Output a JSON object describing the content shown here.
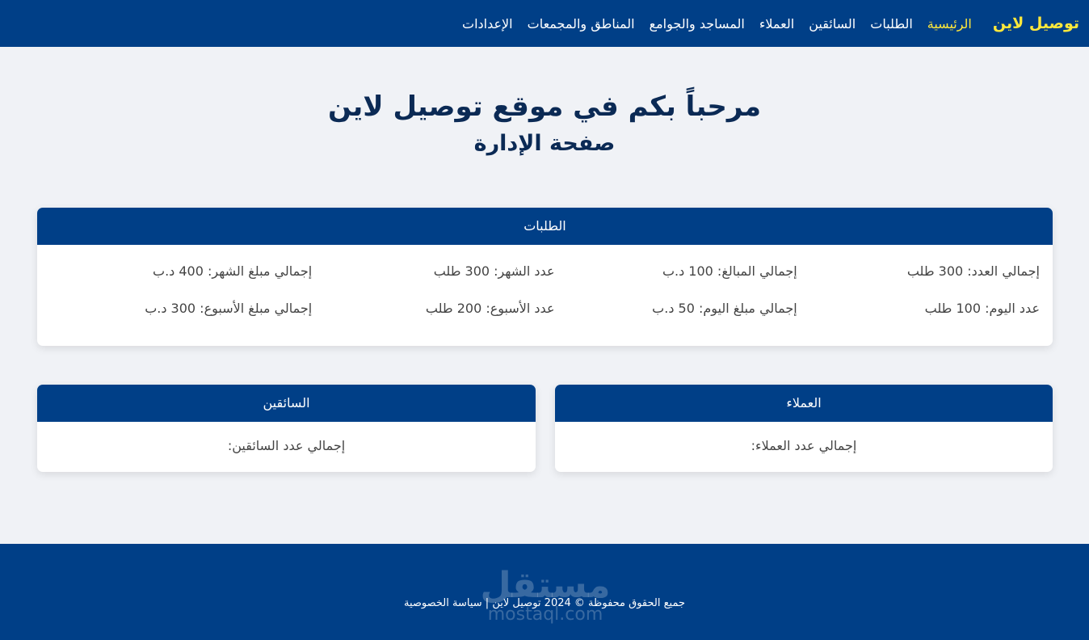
{
  "nav": {
    "brand": "توصيل لاين",
    "links": [
      "الرئيسية",
      "الطلبات",
      "السائقين",
      "العملاء",
      "المساجد والجوامع",
      "المناطق والمجمعات",
      "الإعدادات"
    ],
    "active_index": 0
  },
  "hero": {
    "title": "مرحباً بكم في موقع توصيل لاين",
    "subtitle": "صفحة الإدارة"
  },
  "orders": {
    "header": "الطلبات",
    "stats": [
      "إجمالي العدد: 300 طلب",
      "إجمالي المبالغ: 100 د.ب",
      "عدد الشهر: 300 طلب",
      "إجمالي مبلغ الشهر: 400 د.ب",
      "عدد اليوم: 100 طلب",
      "إجمالي مبلغ اليوم: 50 د.ب",
      "عدد الأسبوع: 200 طلب",
      "إجمالي مبلغ الأسبوع: 300 د.ب"
    ]
  },
  "customers": {
    "header": "العملاء",
    "total_label": "إجمالي عدد العملاء:"
  },
  "drivers": {
    "header": "السائقين",
    "total_label": "إجمالي عدد السائقين:"
  },
  "footer": {
    "copyright": "جميع الحقوق محفوظة © 2024 توصيل لاين",
    "separator": "|",
    "privacy": "سياسة الخصوصية"
  },
  "watermark": {
    "arabic": "مستقل",
    "latin": "mostaql.com"
  },
  "colors": {
    "primary": "#003f87",
    "accent": "#ffe83b",
    "background": "#f0f2f6",
    "heading": "#0b2a55"
  }
}
